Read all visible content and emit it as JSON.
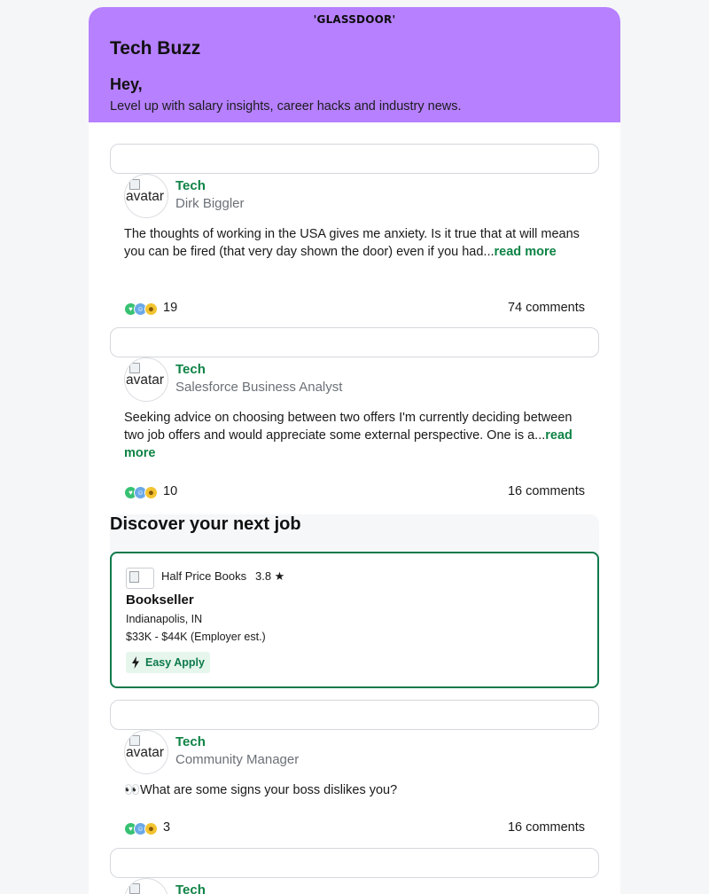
{
  "header": {
    "logo_text": "'GLASSDOOR'",
    "title": "Tech Buzz",
    "greeting": "Hey,",
    "subtitle": "Level up with salary insights, career hacks and industry news."
  },
  "posts": [
    {
      "avatar_alt": "avatar",
      "category": "Tech",
      "author": "Dirk Biggler",
      "body": "The thoughts of working in the USA gives me anxiety. Is it true that at will means you can be fired (that very day shown the door) even if you had...",
      "read_more": "read more",
      "reaction_count": "19",
      "comments": "74 comments"
    },
    {
      "avatar_alt": "avatar",
      "category": "Tech",
      "author": "Salesforce Business Analyst",
      "body": "Seeking advice on choosing between two offers I'm currently deciding between two job offers and would appreciate some external perspective. One is a...",
      "read_more": "read more",
      "reaction_count": "10",
      "comments": "16 comments"
    },
    {
      "avatar_alt": "avatar",
      "category": "Tech",
      "author": "Community Manager",
      "body": "👀What are some signs your boss dislikes you?",
      "read_more": "",
      "reaction_count": "3",
      "comments": "16 comments"
    },
    {
      "avatar_alt": "avatar",
      "category": "Tech",
      "author": "",
      "body": "",
      "read_more": "",
      "reaction_count": "",
      "comments": ""
    }
  ],
  "discover": {
    "title": "Discover your next job",
    "job": {
      "company": "Half Price Books",
      "rating": "3.8 ★",
      "title": "Bookseller",
      "location": "Indianapolis, IN",
      "salary": "$33K - $44K (Employer est.)",
      "easy_apply": "Easy Apply"
    }
  },
  "icons": {
    "reaction_heart": "heart-reaction-icon",
    "reaction_face": "face-reaction-icon",
    "reaction_smile": "smile-reaction-icon",
    "easy_apply": "lightning-bolt-icon"
  },
  "colors": {
    "hero_bg": "#b680ff",
    "accent_green": "#0e8345",
    "job_border": "#0e7a4a"
  }
}
